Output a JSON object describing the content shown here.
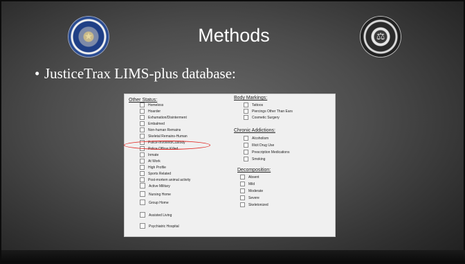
{
  "slide": {
    "title": "Methods",
    "bullet": "JusticeTrax LIMS-plus database:"
  },
  "left_seal": {
    "ring_text_top": "THE COUNTY OF DALLAS",
    "ring_text_bottom": "STATE OF TEXAS",
    "icon": "star-seal-icon"
  },
  "right_seal": {
    "ring_text_top": "DALLAS COUNTY",
    "ring_text_bottom": "MEDICAL EXAMINER",
    "icon": "scales-seal-icon"
  },
  "form": {
    "other_status": {
      "heading": "Other Status:",
      "items": [
        "Homeless",
        "Hoarder",
        "Exhumation/Disinterment",
        "Embalmed",
        "Non-human Remains",
        "Skeletal Remains-Human",
        "Police-Involved/Custody",
        "Police Officer Killed",
        "Inmate",
        "At Work",
        "High Profile",
        "Sports Related",
        "Post-mortem animal activity",
        "Active Military",
        "Nursing Home",
        "Group Home",
        "Assisted Living",
        "Psychiatric Hospital"
      ]
    },
    "body_markings": {
      "heading": "Body Markings:",
      "items": [
        "Tattoos",
        "Piercings Other Than Ears",
        "Cosmetic Surgery"
      ]
    },
    "chronic_addictions": {
      "heading": "Chronic Addictions:",
      "items": [
        "Alcoholism",
        "Illicit Drug Use",
        "Prescription Medications",
        "Smoking"
      ]
    },
    "decomposition": {
      "heading": "Decomposition:",
      "items": [
        "Absent",
        "Mild",
        "Moderate",
        "Severe",
        "Skeletonized"
      ]
    },
    "highlight_color": "#e0201c"
  }
}
